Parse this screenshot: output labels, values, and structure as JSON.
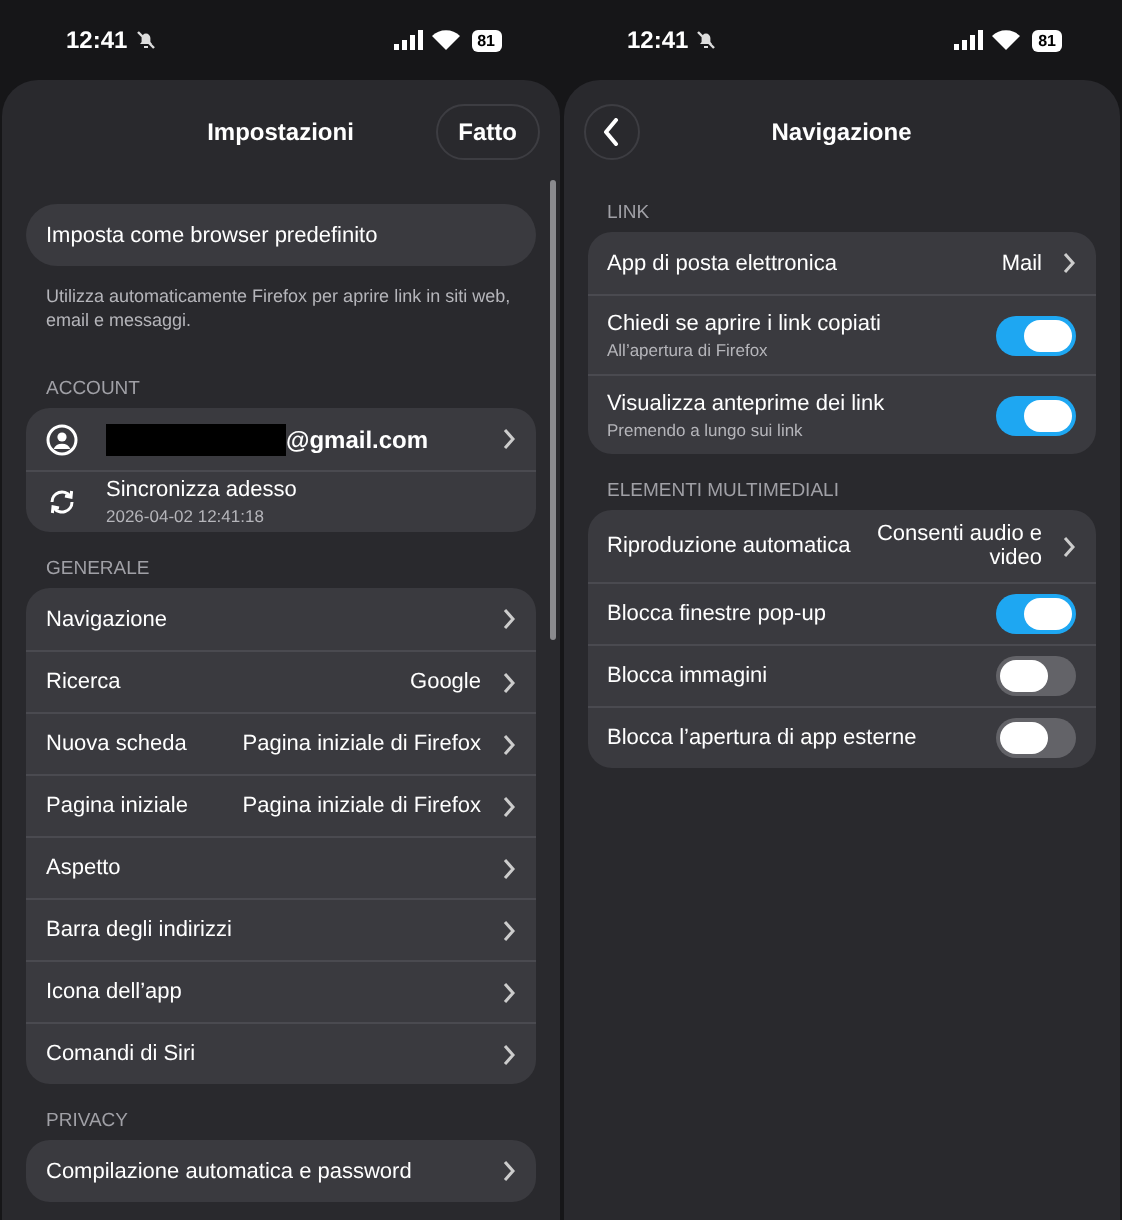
{
  "screens": [
    {
      "status_bar": {
        "time": "12:41",
        "battery": "81"
      },
      "header": {
        "title": "Impostazioni",
        "done_label": "Fatto"
      },
      "scrollable": true,
      "sections": [
        {
          "rows": [
            {
              "kind": "plain",
              "label": "Imposta come browser predefinito"
            }
          ],
          "footer": "Utilizza automaticamente Firefox per aprire link in siti web, email e messaggi."
        },
        {
          "header": "ACCOUNT",
          "rows": [
            {
              "kind": "account",
              "label": "@gmail.com",
              "redacted": true
            },
            {
              "kind": "sync",
              "label": "Sincronizza adesso",
              "subtitle": "2026-04-02 12:41:18"
            }
          ]
        },
        {
          "header": "GENERALE",
          "rows": [
            {
              "kind": "link",
              "label": "Navigazione"
            },
            {
              "kind": "link",
              "label": "Ricerca",
              "value": "Google"
            },
            {
              "kind": "link",
              "label": "Nuova scheda",
              "value": "Pagina iniziale di Firefox"
            },
            {
              "kind": "link",
              "label": "Pagina iniziale",
              "value": "Pagina iniziale di Firefox"
            },
            {
              "kind": "link",
              "label": "Aspetto"
            },
            {
              "kind": "link",
              "label": "Barra degli indirizzi"
            },
            {
              "kind": "link",
              "label": "Icona dell’app"
            },
            {
              "kind": "link",
              "label": "Comandi di Siri"
            }
          ]
        },
        {
          "header": "PRIVACY",
          "rows": [
            {
              "kind": "link",
              "label": "Compilazione automatica e password"
            }
          ]
        }
      ]
    },
    {
      "status_bar": {
        "time": "12:41",
        "battery": "81"
      },
      "header": {
        "title": "Navigazione",
        "back_button": true
      },
      "sections": [
        {
          "header": "LINK",
          "rows": [
            {
              "kind": "link",
              "label": "App di posta elettronica",
              "value": "Mail"
            },
            {
              "kind": "toggle",
              "label": "Chiedi se aprire i link copiati",
              "subtitle": "All’apertura di Firefox",
              "on": true
            },
            {
              "kind": "toggle",
              "label": "Visualizza anteprime dei link",
              "subtitle": "Premendo a lungo sui link",
              "on": true
            }
          ]
        },
        {
          "header": "ELEMENTI MULTIMEDIALI",
          "rows": [
            {
              "kind": "link",
              "label": "Riproduzione automatica",
              "value": "Consenti audio e video"
            },
            {
              "kind": "toggle",
              "label": "Blocca finestre pop-up",
              "on": true
            },
            {
              "kind": "toggle",
              "label": "Blocca immagini",
              "on": false
            },
            {
              "kind": "toggle",
              "label": "Blocca l’apertura di app esterne",
              "on": false
            }
          ]
        }
      ]
    }
  ]
}
